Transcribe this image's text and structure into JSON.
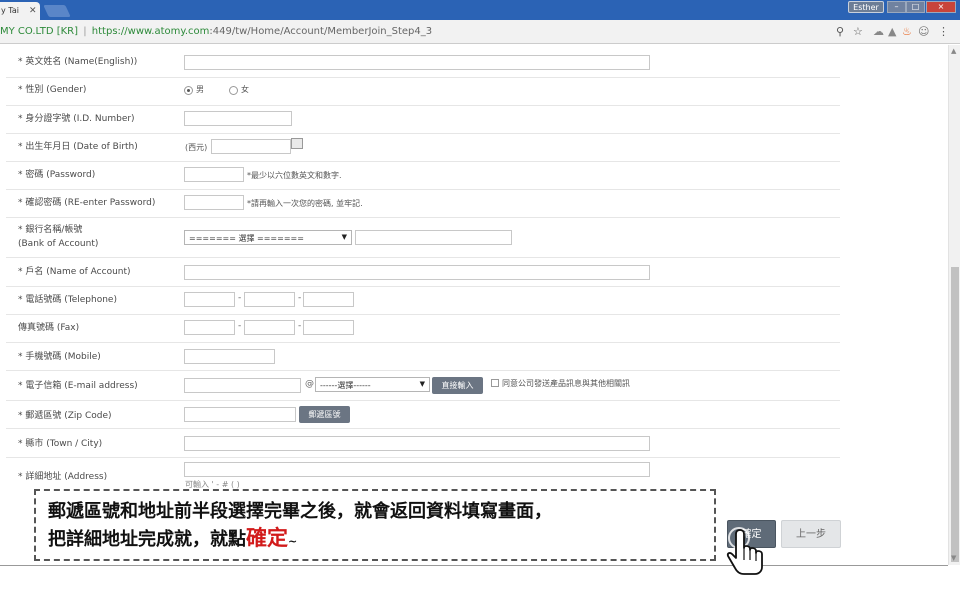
{
  "browser": {
    "tab_title": "y Tai",
    "user_name": "Esther",
    "window_controls": [
      "–",
      "□",
      "×"
    ],
    "site_label": "MY CO.LTD [KR]",
    "separator": "|",
    "url_host": "https://www.atomy.com",
    "url_path": ":449/tw/Home/Account/MemberJoin_Step4_3",
    "toolbar_icons": [
      "zoom-icon",
      "star-icon",
      "extension-icon",
      "extension-icon",
      "fire-icon",
      "smiley-icon",
      "menu-icon"
    ]
  },
  "form": {
    "name_en": {
      "label": "* 英文姓名 (Name(English))"
    },
    "gender": {
      "label": "* 性別 (Gender)",
      "male": "男",
      "female": "女",
      "selected": "male"
    },
    "id_number": {
      "label": "* 身分證字號 (I.D. Number)"
    },
    "birth": {
      "label": "* 出生年月日 (Date of Birth)",
      "prefix": "(西元)"
    },
    "password": {
      "label": "* 密碼 (Password)",
      "hint": "*最少以六位數英文和數字."
    },
    "password_confirm": {
      "label": "* 確認密碼 (RE-enter Password)",
      "hint": "*請再輸入一次您的密碼, 並牢記."
    },
    "bank": {
      "label_1": "* 銀行名稱/帳號",
      "label_2": "(Bank of Account)",
      "select": "======= 選擇 ======="
    },
    "account_name": {
      "label": "* 戶名 (Name of Account)"
    },
    "telephone": {
      "label": "* 電話號碼 (Telephone)",
      "dash": "-"
    },
    "fax": {
      "label": "傳真號碼 (Fax)",
      "dash": "-"
    },
    "mobile": {
      "label": "* 手機號碼 (Mobile)"
    },
    "email": {
      "label": "* 電子信箱 (E-mail address)",
      "at": "@",
      "select": "------選擇------",
      "direct_button": "直接輸入",
      "consent": "同意公司發送產品訊息與其他相關訊"
    },
    "zip": {
      "label": "* 郵遞區號 (Zip Code)",
      "button": "郵遞區號"
    },
    "city": {
      "label": "* 縣市 (Town / City)"
    },
    "address": {
      "label": "* 詳細地址 (Address)",
      "hint": "可輸入 ' - # ( )"
    }
  },
  "actions": {
    "confirm": "確定",
    "previous": "上一步"
  },
  "caption": {
    "line1": "郵遞區號和地址前半段選擇完畢之後，就會返回資料填寫畫面，",
    "line2_prefix": "把詳細地址完成就，就點",
    "line2_highlight": "確定",
    "line2_suffix": "~",
    "highlight_color": "#d21a1a"
  }
}
